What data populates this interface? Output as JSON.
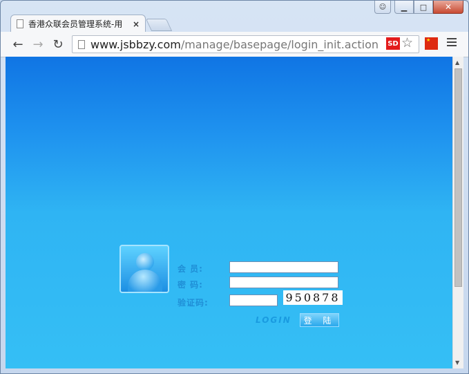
{
  "browser": {
    "tab_title": "香港众联会员管理系统-用",
    "tab_close": "×",
    "url_host": "www.jsbbzy.com",
    "url_path": "/manage/basepage/login_init.action",
    "extension_label": "SD",
    "window_buttons": {
      "minimize": "▁",
      "maximize": "□",
      "close": "✕"
    },
    "nav": {
      "back": "←",
      "forward": "→",
      "reload": "↻"
    },
    "star": "☆",
    "flag_label": "★",
    "scroll_up": "▲",
    "scroll_down": "▼"
  },
  "login": {
    "member_label": "会 员:",
    "password_label": "密 码:",
    "captcha_label": "验证码:",
    "member_value": "",
    "password_value": "",
    "captcha_value": "",
    "captcha_code": "950878",
    "login_text": "LOGIN",
    "login_button": "登 陆"
  },
  "icons": [
    "user-icon",
    "file-icon",
    "star-icon",
    "menu-icon",
    "back-icon",
    "forward-icon",
    "reload-icon",
    "china-flag-icon",
    "avatar-icon"
  ],
  "colors": {
    "page_top": "#1075e4",
    "page_bottom": "#35bff5",
    "label": "#1f8fd6"
  }
}
